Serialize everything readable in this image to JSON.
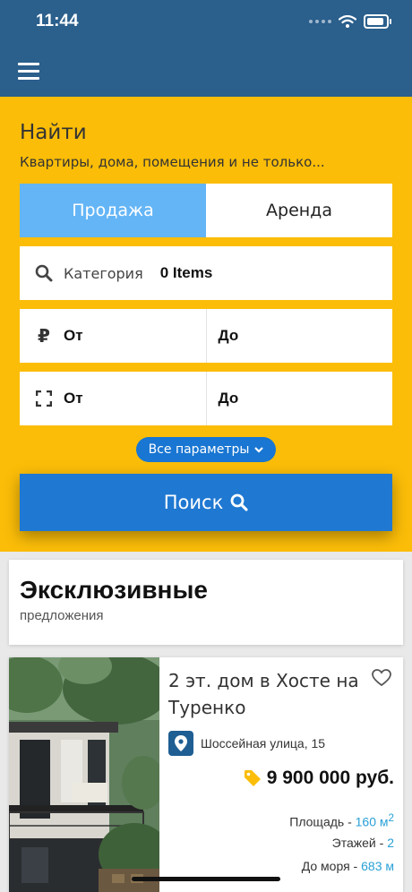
{
  "status_bar": {
    "time": "11:44"
  },
  "search": {
    "title": "Найти",
    "subtitle": "Квартиры, дома, помещения и не только...",
    "tabs": [
      {
        "label": "Продажа",
        "active": true
      },
      {
        "label": "Аренда",
        "active": false
      }
    ],
    "category": {
      "label": "Категория",
      "value": "0 Items"
    },
    "price": {
      "from": "От",
      "to": "До",
      "icon": "ruble-icon"
    },
    "area": {
      "from": "От",
      "to": "До",
      "icon": "area-frame-icon"
    },
    "more_label": "Все параметры",
    "find_label": "Поиск"
  },
  "exclusive": {
    "title": "Эксклюзивные",
    "subtitle": "предложения"
  },
  "listing": {
    "title": "2 эт. дом в Хосте на Туренко",
    "address": "Шоссейная улица, 15",
    "price": "9 900 000 руб.",
    "specs": [
      {
        "label": "Площадь - ",
        "value": "160 м",
        "sup": "2"
      },
      {
        "label": "Этажей - ",
        "value": "2",
        "sup": ""
      },
      {
        "label": "До моря - ",
        "value": "683 м",
        "sup": ""
      }
    ]
  },
  "colors": {
    "header": "#2b5f8c",
    "panel": "#fbbd08",
    "accent": "#1976d2",
    "tab_active": "#64b5f6",
    "value": "#29a0d6"
  }
}
